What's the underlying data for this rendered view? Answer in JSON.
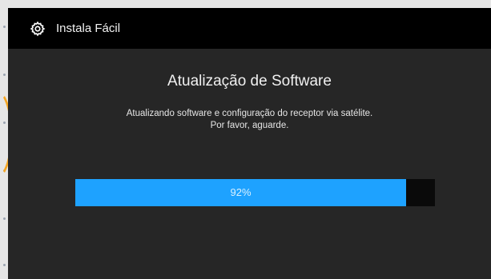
{
  "window": {
    "title": "Instala Fácil",
    "icon": "gear-icon"
  },
  "dialog": {
    "heading": "Atualização de Software",
    "message_line1": "Atualizando software e configuração do receptor via satélite.",
    "message_line2": "Por favor, aguarde."
  },
  "progress": {
    "value": 0.92,
    "label": "92%",
    "fill_color": "#1ea2ff",
    "track_color": "#0a0a0a"
  },
  "colors": {
    "titlebar": "#000000",
    "background": "#262626"
  }
}
